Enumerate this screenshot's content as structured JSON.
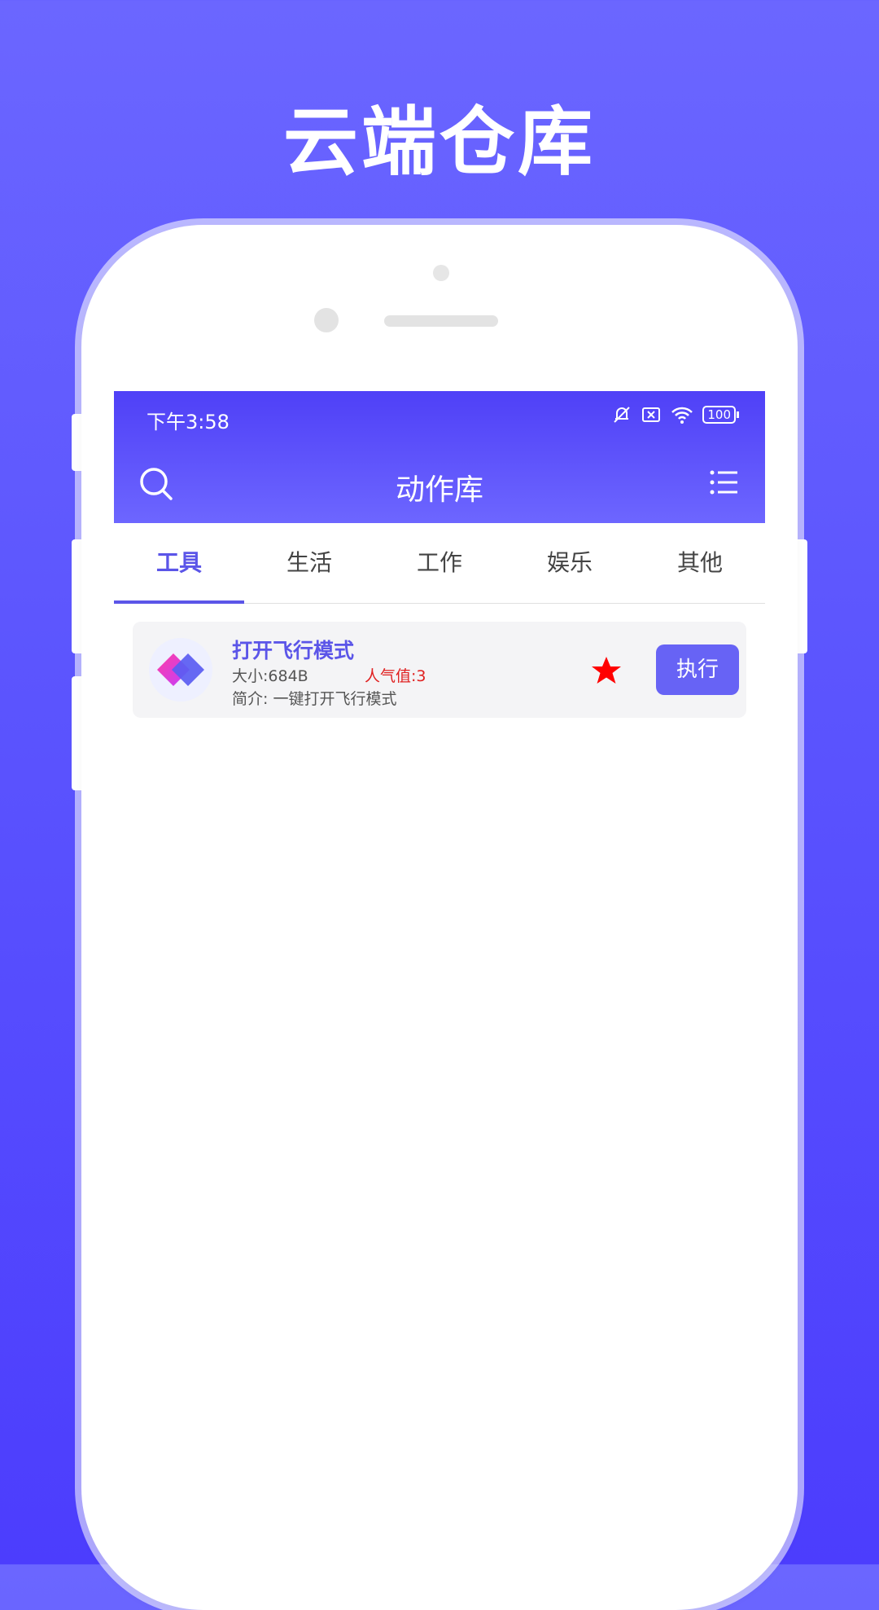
{
  "hero": {
    "title": "云端仓库"
  },
  "status_bar": {
    "time": "下午3:58",
    "battery": "100"
  },
  "app_bar": {
    "title": "动作库"
  },
  "tabs": [
    {
      "label": "工具",
      "active": true
    },
    {
      "label": "生活",
      "active": false
    },
    {
      "label": "工作",
      "active": false
    },
    {
      "label": "娱乐",
      "active": false
    },
    {
      "label": "其他",
      "active": false
    }
  ],
  "items": [
    {
      "title": "打开飞行模式",
      "size": "大小:684B",
      "popularity": "人气值:3",
      "description": "简介: 一键打开飞行模式",
      "favorited": true,
      "action_label": "执行"
    }
  ],
  "colors": {
    "accent": "#5b55e8",
    "button": "#6763f5",
    "popularity": "#e02020",
    "star": "#ff0000"
  },
  "icons": {
    "search": "search-icon",
    "menu": "list-menu-icon",
    "favorite": "star-icon",
    "item": "diamond-app-icon"
  }
}
